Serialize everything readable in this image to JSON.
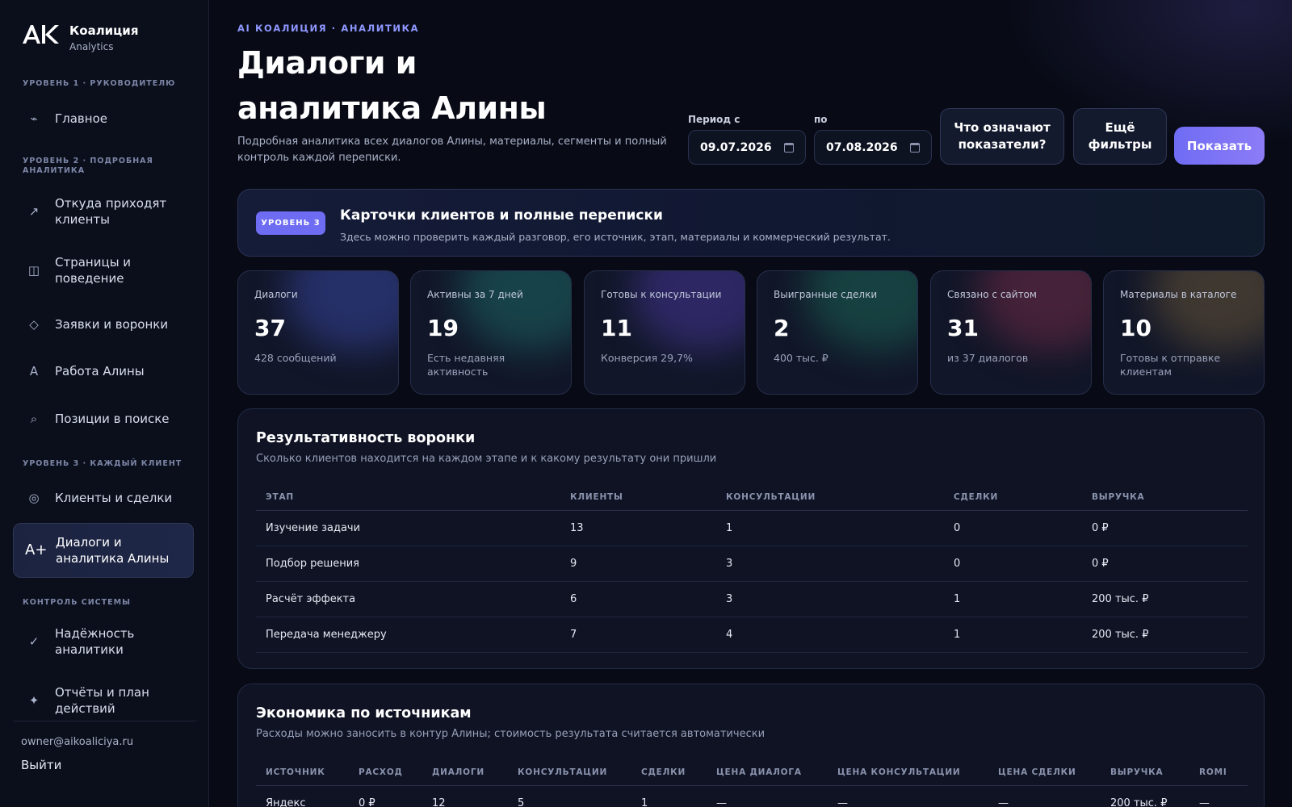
{
  "brand": {
    "logo_text": "AK",
    "name": "Коалиция",
    "sub": "Analytics"
  },
  "sidebar": {
    "sections": [
      "Уровень 1 · руководителю",
      "Уровень 2 · подробная аналитика",
      "Уровень 3 · каждый клиент",
      "Контроль системы"
    ],
    "items": [
      {
        "icon": "pulse-icon",
        "glyph": "⌁",
        "label": "Главное"
      },
      {
        "icon": "trend-arrow-icon",
        "glyph": "↗",
        "label": "Откуда приходят клиенты"
      },
      {
        "icon": "columns-icon",
        "glyph": "◫",
        "label": "Страницы и поведение"
      },
      {
        "icon": "diamond-icon",
        "glyph": "◇",
        "label": "Заявки и воронки"
      },
      {
        "icon": "letter-a-icon",
        "glyph": "A",
        "label": "Работа Алины"
      },
      {
        "icon": "search-icon",
        "glyph": "⌕",
        "label": "Позиции в поиске"
      },
      {
        "icon": "target-icon",
        "glyph": "◎",
        "label": "Клиенты и сделки"
      },
      {
        "icon": "a-plus-icon",
        "glyph": "A+",
        "label": "Диалоги и аналитика Алины"
      },
      {
        "icon": "check-icon",
        "glyph": "✓",
        "label": "Надёжность аналитики"
      },
      {
        "icon": "sparkle-icon",
        "glyph": "✦",
        "label": "Отчёты и план действий"
      }
    ],
    "active_index": 7,
    "email": "owner@aikoaliciya.ru",
    "logout": "Выйти"
  },
  "header": {
    "kicker": "AI КОАЛИЦИЯ · АНАЛИТИКА",
    "title": "Диалоги и аналитика Алины",
    "description": "Подробная аналитика всех диалогов Алины, материалы, сегменты и полный контроль каждой переписки."
  },
  "filters": {
    "from_label": "Период с",
    "from_value": "09.07.2026",
    "to_label": "по",
    "to_value": "07.08.2026",
    "explain_button": "Что означают показатели?",
    "more_filters_button": "Ещё фильтры",
    "show_button": "Показать"
  },
  "banner": {
    "badge": "УРОВЕНЬ 3",
    "title": "Карточки клиентов и полные переписки",
    "description": "Здесь можно проверить каждый разговор, его источник, этап, материалы и коммерческий результат."
  },
  "stats": [
    {
      "label": "Диалоги",
      "value": "37",
      "note": "428 сообщений",
      "glow": "#3b4aa8"
    },
    {
      "label": "Активны за 7 дней",
      "value": "19",
      "note": "Есть недавняя активность",
      "glow": "#1f6e6a"
    },
    {
      "label": "Готовы к консультации",
      "value": "11",
      "note": "Конверсия 29,7%",
      "glow": "#4a3aa0"
    },
    {
      "label": "Выигранные сделки",
      "value": "2",
      "note": "400 тыс. ₽",
      "glow": "#1d6b5a"
    },
    {
      "label": "Связано с сайтом",
      "value": "31",
      "note": "из 37 диалогов",
      "glow": "#7a2e4a"
    },
    {
      "label": "Материалы в каталоге",
      "value": "10",
      "note": "Готовы к отправке клиентам",
      "glow": "#6e5a3a"
    }
  ],
  "funnel": {
    "title": "Результативность воронки",
    "subtitle": "Сколько клиентов находится на каждом этапе и к какому результату они пришли",
    "columns": [
      "ЭТАП",
      "КЛИЕНТЫ",
      "КОНСУЛЬТАЦИИ",
      "СДЕЛКИ",
      "ВЫРУЧКА"
    ],
    "rows": [
      [
        "Изучение задачи",
        "13",
        "1",
        "0",
        "0 ₽"
      ],
      [
        "Подбор решения",
        "9",
        "3",
        "0",
        "0 ₽"
      ],
      [
        "Расчёт эффекта",
        "6",
        "3",
        "1",
        "200 тыс. ₽"
      ],
      [
        "Передача менеджеру",
        "7",
        "4",
        "1",
        "200 тыс. ₽"
      ]
    ]
  },
  "economics": {
    "title": "Экономика по источникам",
    "subtitle": "Расходы можно заносить в контур Алины; стоимость результата считается автоматически",
    "columns": [
      "ИСТОЧНИК",
      "РАСХОД",
      "ДИАЛОГИ",
      "КОНСУЛЬТАЦИИ",
      "СДЕЛКИ",
      "ЦЕНА ДИАЛОГА",
      "ЦЕНА КОНСУЛЬТАЦИИ",
      "ЦЕНА СДЕЛКИ",
      "ВЫРУЧКА",
      "ROMI"
    ],
    "rows": [
      [
        "Яндекс",
        "0 ₽",
        "12",
        "5",
        "1",
        "—",
        "—",
        "—",
        "200 тыс. ₽",
        "—"
      ]
    ]
  }
}
